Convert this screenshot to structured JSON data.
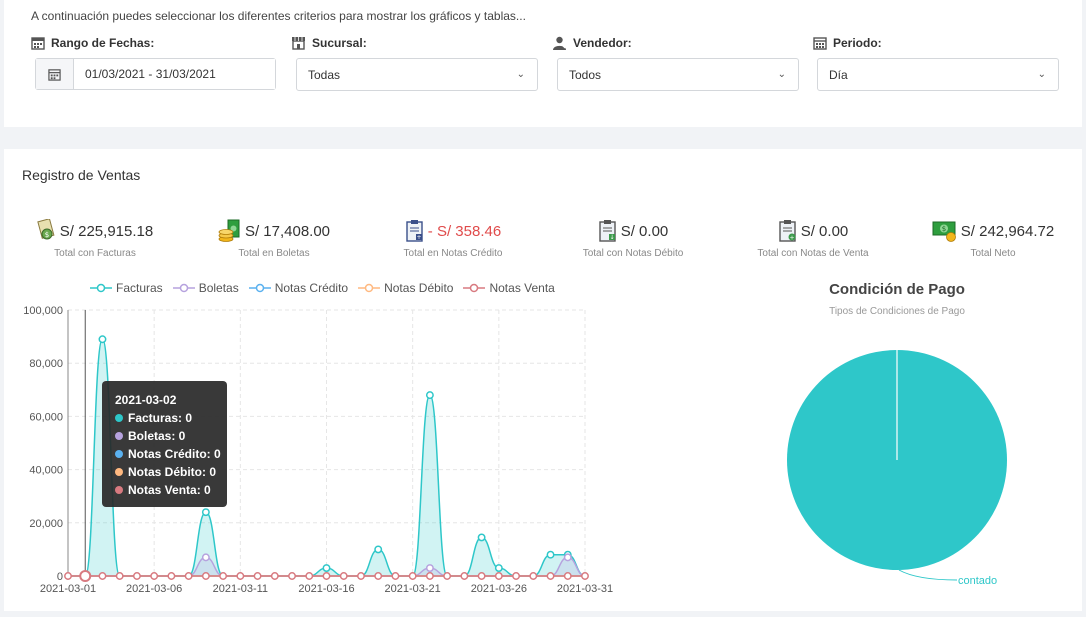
{
  "filters": {
    "intro": "A continuación puedes seleccionar los diferentes criterios para mostrar los gráficos y tablas...",
    "date_label": "Rango de Fechas:",
    "date_value": "01/03/2021 - 31/03/2021",
    "branch_label": "Sucursal:",
    "branch_value": "Todas",
    "seller_label": "Vendedor:",
    "seller_value": "Todos",
    "period_label": "Periodo:",
    "period_value": "Día"
  },
  "sales": {
    "title": "Registro de Ventas",
    "stats": [
      {
        "value": "S/ 225,915.18",
        "label": "Total con Facturas",
        "icon": "invoice-icon"
      },
      {
        "value": "S/ 17,408.00",
        "label": "Total en Boletas",
        "icon": "money-coins-icon"
      },
      {
        "value": "- S/ 358.46",
        "label": "Total en Notas Crédito",
        "icon": "clipboard-credit-icon",
        "color": "#e04b4b"
      },
      {
        "value": "S/ 0.00",
        "label": "Total con Notas Débito",
        "icon": "clipboard-debit-icon"
      },
      {
        "value": "S/ 0.00",
        "label": "Total con Notas de Venta",
        "icon": "clipboard-sale-icon"
      },
      {
        "value": "S/ 242,964.72",
        "label": "Total Neto",
        "icon": "cash-icon"
      }
    ]
  },
  "tooltip": {
    "date": "2021-03-02",
    "rows": [
      {
        "text": "Facturas: 0",
        "color": "#2ec7c9"
      },
      {
        "text": "Boletas: 0",
        "color": "#b6a2de"
      },
      {
        "text": "Notas Crédito: 0",
        "color": "#5ab1ef"
      },
      {
        "text": "Notas Débito: 0",
        "color": "#ffb980"
      },
      {
        "text": "Notas Venta: 0",
        "color": "#d87a80"
      }
    ]
  },
  "chart_data": [
    {
      "type": "area",
      "x": [
        "2021-03-01",
        "2021-03-02",
        "2021-03-03",
        "2021-03-04",
        "2021-03-05",
        "2021-03-06",
        "2021-03-07",
        "2021-03-08",
        "2021-03-09",
        "2021-03-10",
        "2021-03-11",
        "2021-03-12",
        "2021-03-13",
        "2021-03-14",
        "2021-03-15",
        "2021-03-16",
        "2021-03-17",
        "2021-03-18",
        "2021-03-19",
        "2021-03-20",
        "2021-03-21",
        "2021-03-22",
        "2021-03-23",
        "2021-03-24",
        "2021-03-25",
        "2021-03-26",
        "2021-03-27",
        "2021-03-28",
        "2021-03-29",
        "2021-03-30",
        "2021-03-31"
      ],
      "x_tick_labels": [
        "2021-03-01",
        "2021-03-06",
        "2021-03-11",
        "2021-03-16",
        "2021-03-21",
        "2021-03-26",
        "2021-03-31"
      ],
      "ylim": [
        0,
        100000
      ],
      "y_tick_labels": [
        "0",
        "20,000",
        "40,000",
        "60,000",
        "80,000",
        "100,000"
      ],
      "grid": true,
      "legend": "top",
      "series": [
        {
          "name": "Facturas",
          "color": "#2ec7c9",
          "values": [
            0,
            0,
            89000,
            0,
            0,
            0,
            0,
            0,
            24000,
            0,
            0,
            0,
            0,
            0,
            0,
            3000,
            0,
            0,
            10000,
            0,
            0,
            68000,
            0,
            0,
            14500,
            3000,
            0,
            0,
            8000,
            8000,
            0
          ]
        },
        {
          "name": "Boletas",
          "color": "#b6a2de",
          "values": [
            0,
            0,
            0,
            0,
            0,
            0,
            0,
            0,
            7000,
            0,
            0,
            0,
            0,
            0,
            0,
            0,
            0,
            0,
            0,
            0,
            0,
            3000,
            0,
            0,
            0,
            0,
            0,
            0,
            0,
            7000,
            0
          ]
        },
        {
          "name": "Notas Crédito",
          "color": "#5ab1ef",
          "values": [
            0,
            0,
            0,
            0,
            0,
            0,
            0,
            0,
            0,
            0,
            0,
            0,
            0,
            0,
            0,
            0,
            0,
            0,
            0,
            0,
            0,
            0,
            0,
            0,
            0,
            0,
            0,
            0,
            0,
            0,
            0
          ]
        },
        {
          "name": "Notas Débito",
          "color": "#ffb980",
          "values": [
            0,
            0,
            0,
            0,
            0,
            0,
            0,
            0,
            0,
            0,
            0,
            0,
            0,
            0,
            0,
            0,
            0,
            0,
            0,
            0,
            0,
            0,
            0,
            0,
            0,
            0,
            0,
            0,
            0,
            0,
            0
          ]
        },
        {
          "name": "Notas Venta",
          "color": "#d87a80",
          "values": [
            0,
            0,
            0,
            0,
            0,
            0,
            0,
            0,
            0,
            0,
            0,
            0,
            0,
            0,
            0,
            0,
            0,
            0,
            0,
            0,
            0,
            0,
            0,
            0,
            0,
            0,
            0,
            0,
            0,
            0,
            0
          ]
        }
      ]
    },
    {
      "type": "pie",
      "title": "Condición de Pago",
      "subtitle": "Tipos de Condiciones de Pago",
      "slices": [
        {
          "label": "contado",
          "value": 100,
          "color": "#2ec7c9"
        }
      ]
    }
  ]
}
